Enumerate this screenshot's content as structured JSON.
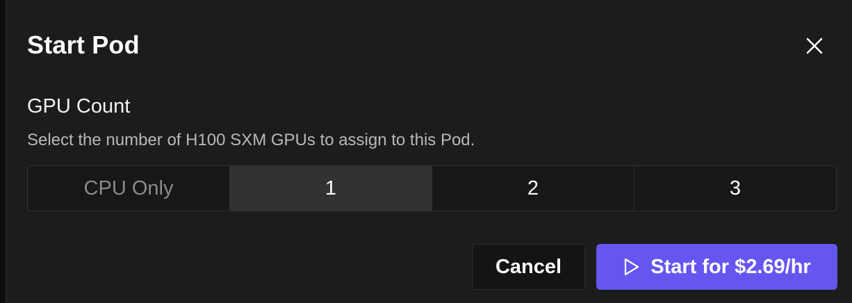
{
  "dialog": {
    "title": "Start Pod",
    "close_icon": "close-icon"
  },
  "gpu_count": {
    "label": "GPU Count",
    "description": "Select the number of H100 SXM GPUs to assign to this Pod.",
    "options": [
      {
        "label": "CPU Only",
        "state": "disabled"
      },
      {
        "label": "1",
        "state": "selected"
      },
      {
        "label": "2",
        "state": "default"
      },
      {
        "label": "3",
        "state": "default"
      }
    ]
  },
  "actions": {
    "cancel_label": "Cancel",
    "start_label": "Start for $2.69/hr",
    "start_icon": "play-icon"
  },
  "colors": {
    "accent": "#6656f0",
    "dialog_bg": "#1c1c1c",
    "selected_bg": "#323232"
  }
}
